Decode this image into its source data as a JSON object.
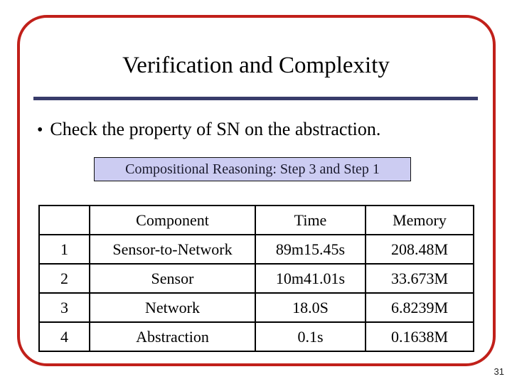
{
  "slide": {
    "title": "Verification and Complexity",
    "page_number": "31",
    "frame_color": "#c1201a",
    "rule_color": "#383c6b"
  },
  "bullets": [
    {
      "marker": "•",
      "text": "Check the property of SN on the abstraction."
    }
  ],
  "callout": {
    "text": "Compositional Reasoning: Step 3 and Step 1",
    "background": "#ccccf2",
    "border_color": "#101010"
  },
  "table": {
    "headers": [
      "",
      "Component",
      "Time",
      "Memory"
    ],
    "rows": [
      {
        "index": "1",
        "component": "Sensor-to-Network",
        "time": "89m15.45s",
        "memory": "208.48M",
        "highlight": false
      },
      {
        "index": "2",
        "component": "Sensor",
        "time": "10m41.01s",
        "memory": "33.673M",
        "highlight": false
      },
      {
        "index": "3",
        "component": "Network",
        "time": "18.0S",
        "memory": "6.8239M",
        "highlight": false
      },
      {
        "index": "4",
        "component": "Abstraction",
        "time": "0.1s",
        "memory": "0.1638M",
        "highlight": true
      }
    ],
    "highlight_color": "#3b3b8c"
  }
}
